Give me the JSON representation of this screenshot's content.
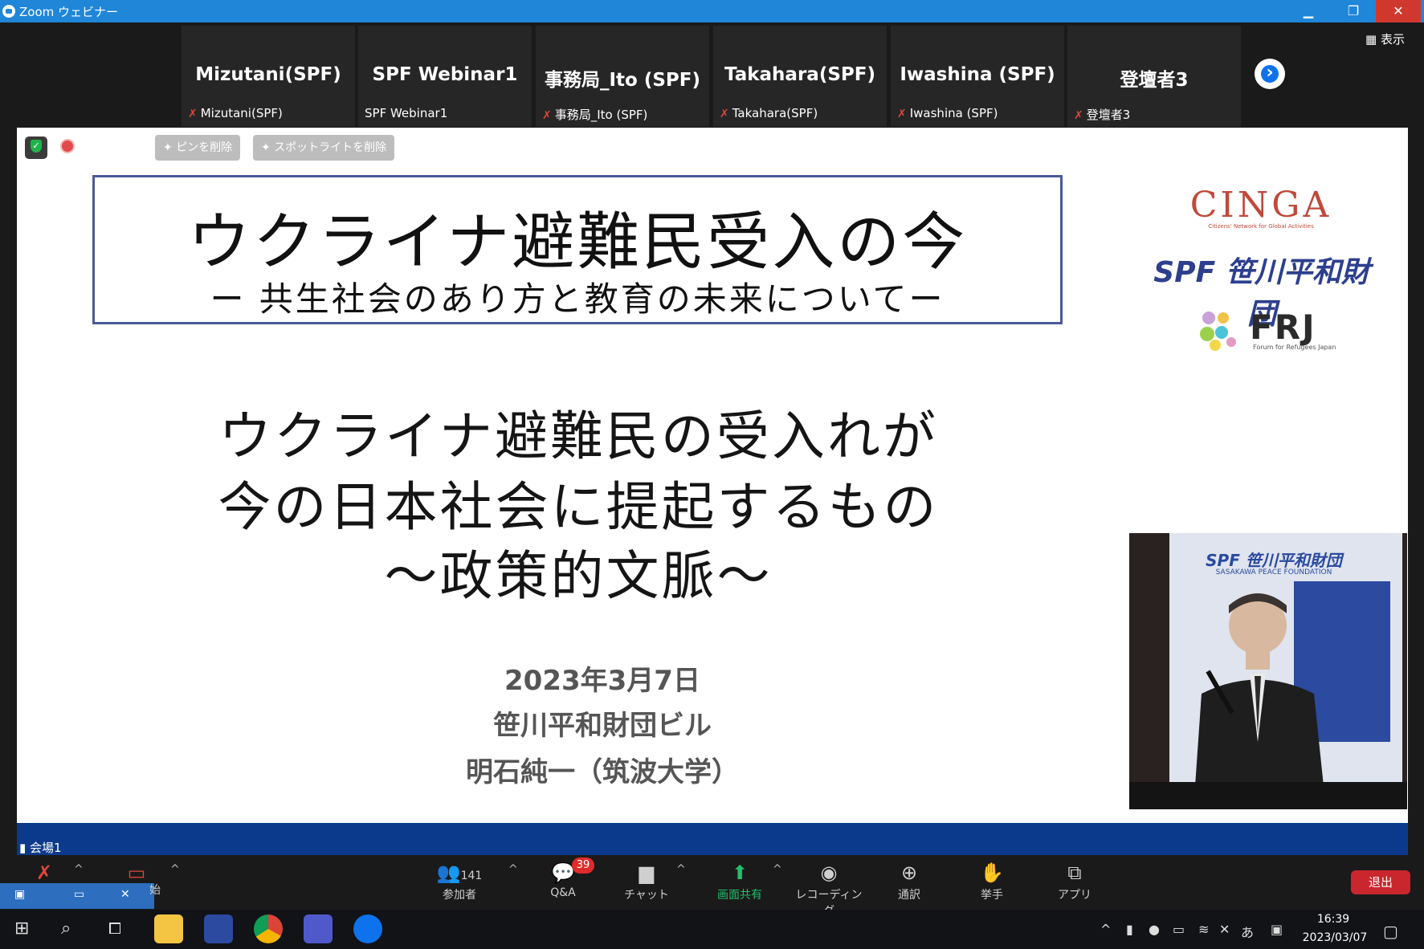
{
  "window": {
    "title": "Zoom ウェビナー",
    "minimize": "▁",
    "restore": "❐",
    "close": "✕"
  },
  "strip": {
    "view_label": "表示",
    "next_icon": "›",
    "tiles": [
      {
        "name": "Mizutani(SPF)",
        "label": "Mizutani(SPF)",
        "muted": true
      },
      {
        "name": "SPF Webinar1",
        "label": "SPF Webinar1",
        "muted": false
      },
      {
        "name": "事務局_Ito (SPF)",
        "label": "事務局_Ito (SPF)",
        "muted": true
      },
      {
        "name": "Takahara(SPF)",
        "label": "Takahara(SPF)",
        "muted": true
      },
      {
        "name": "Iwashina (SPF)",
        "label": "Iwashina (SPF)",
        "muted": true
      },
      {
        "name": "登壇者3",
        "label": "登壇者3",
        "muted": true
      }
    ]
  },
  "overlay": {
    "unpin": "ピンを削除",
    "remove_spotlight": "スポットライトを削除"
  },
  "slide": {
    "title": "ウクライナ避難民受入の今",
    "subtitle": "ー 共生社会のあり方と教育の未来についてー",
    "main_lines": [
      "ウクライナ避難民の受入れが",
      "今の日本社会に提起するもの",
      "～政策的文脈～"
    ],
    "date": "2023年3月7日",
    "venue": "笹川平和財団ビル",
    "presenter": "明石純一（筑波大学）",
    "logos": {
      "cinga": "CINGA",
      "cinga_sub": "Citizens' Network for Global Activities",
      "spf": "SPF 笹川平和財団",
      "frj": "FRJ",
      "frj_sub": "Forum for Refugees Japan"
    }
  },
  "video": {
    "backdrop_text": "SPF 笹川平和財団",
    "backdrop_sub": "SASAKAWA PEACE FOUNDATION"
  },
  "venue_label": "会場1",
  "toolbar": {
    "participants_label": "参加者",
    "participants_count": "141",
    "qa_label": "Q&A",
    "qa_badge": "39",
    "chat_label": "チャット",
    "share_label": "画面共有",
    "record_label": "レコーディング",
    "interpret_label": "通訳",
    "raise_hand_label": "挙手",
    "apps_label": "アプリ",
    "leave_label": "退出",
    "start_fragment": "始"
  },
  "taskbar": {
    "time": "16:39",
    "date": "2023/03/07",
    "ime": "あ"
  },
  "colors": {
    "titlebar": "#1f86d8",
    "zoom_blue": "#0e72ed",
    "leave_red": "#c9262e",
    "share_green": "#21c06b",
    "label_bar": "#0b3a8c"
  }
}
